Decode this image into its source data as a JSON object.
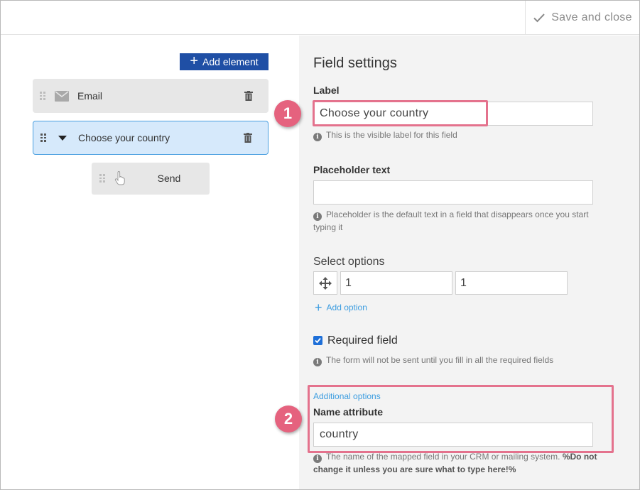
{
  "topbar": {
    "save_close_label": "Save and close"
  },
  "left": {
    "add_element_label": "Add element",
    "elements": [
      {
        "label": "Email",
        "icon": "envelope-icon"
      },
      {
        "label": "Choose your country",
        "icon": "dropdown-caret-icon"
      }
    ],
    "send_label": "Send"
  },
  "settings": {
    "title": "Field settings",
    "label_heading": "Label",
    "label_value": "Choose your country",
    "label_hint": "This is the visible label for this field",
    "placeholder_heading": "Placeholder text",
    "placeholder_value": "",
    "placeholder_hint": "Placeholder is the default text in a field that disappears once you start typing it",
    "select_options_title": "Select options",
    "options": [
      "1",
      "1"
    ],
    "add_option_label": "Add option",
    "required_label": "Required field",
    "required_checked": true,
    "required_hint": "The form will not be sent until you fill in all the required fields",
    "additional_options_link": "Additional options",
    "name_attr_heading": "Name attribute",
    "name_attr_value": "country",
    "name_attr_hint": "The name of the mapped field in your CRM or mailing system.",
    "name_attr_warning": "%Do not change it unless you are sure what to type here!%"
  },
  "annotations": {
    "badge_1": "1",
    "badge_2": "2"
  },
  "colors": {
    "accent": "#1f4fa5",
    "link": "#3d9de0",
    "highlight": "#e4728d",
    "selected_bg": "#d6e9fb"
  }
}
